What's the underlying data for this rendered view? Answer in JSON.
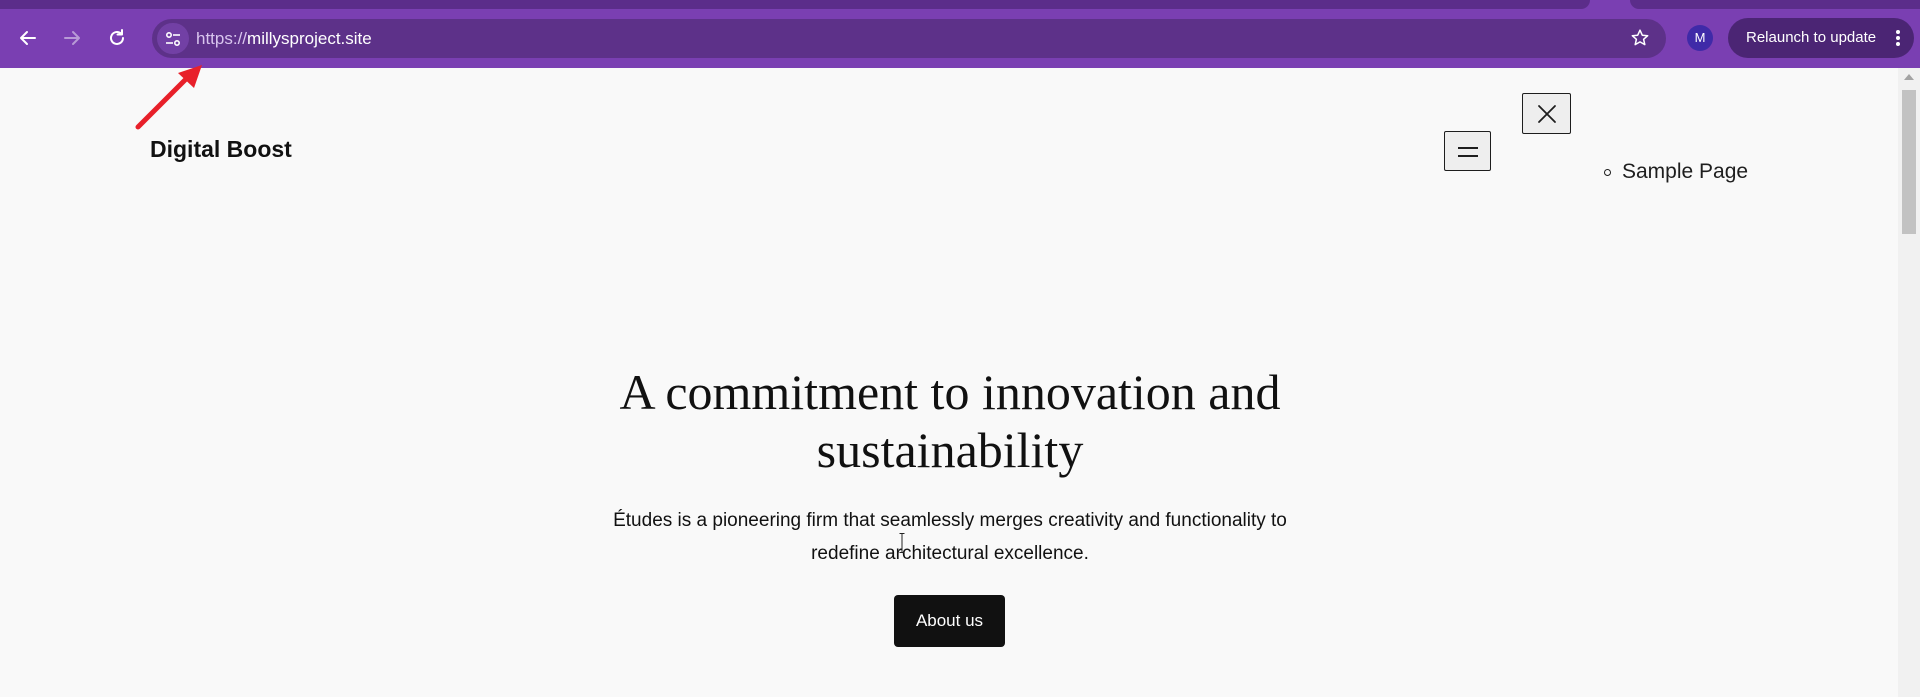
{
  "browser": {
    "url_scheme": "https://",
    "url_host": "millysproject.site",
    "profile_initial": "M",
    "relaunch_label": "Relaunch to update",
    "colors": {
      "frame": "#7a3fb2",
      "omnibox": "#5d3189",
      "profile": "#3f2aa8"
    }
  },
  "page": {
    "site_title": "Digital Boost",
    "menu": {
      "items": [
        {
          "label": "Sample Page"
        }
      ]
    },
    "hero": {
      "heading": "A commitment to innovation and sustainability",
      "text": "Études is a pioneering firm that seamlessly merges creativity and functionality to redefine architectural excellence.",
      "button_label": "About us"
    }
  },
  "annotation": {
    "arrow_color": "#e8202a"
  }
}
